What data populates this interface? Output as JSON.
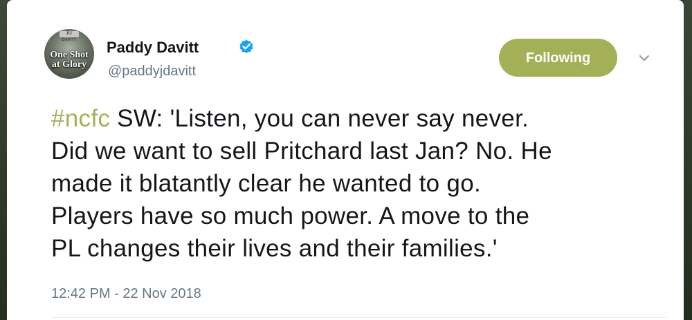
{
  "author": {
    "avatar_text_top": "PJ DAVITT",
    "avatar_text_line1": "One Shot",
    "avatar_text_line2": "at Glory",
    "name": "Paddy Davitt",
    "handle": "@paddyjdavitt",
    "verified_icon": "verified-badge-icon"
  },
  "follow_button": {
    "label": "Following"
  },
  "menu": {
    "icon": "chevron-down-icon"
  },
  "tweet": {
    "hashtag": "#ncfc",
    "line1_rest": " SW: 'Listen, you can never say never.",
    "line2": "Did we want to sell Pritchard last Jan? No. He",
    "line3": "made it blatantly clear he wanted to go.",
    "line4": "Players have so much power. A move to the",
    "line5": "PL changes their lives and their families.'",
    "timestamp": "12:42 PM - 22 Nov 2018"
  },
  "colors": {
    "accent": "#a3b058",
    "handle": "#657786",
    "text": "#14171a",
    "verified": "#1da1f2"
  }
}
